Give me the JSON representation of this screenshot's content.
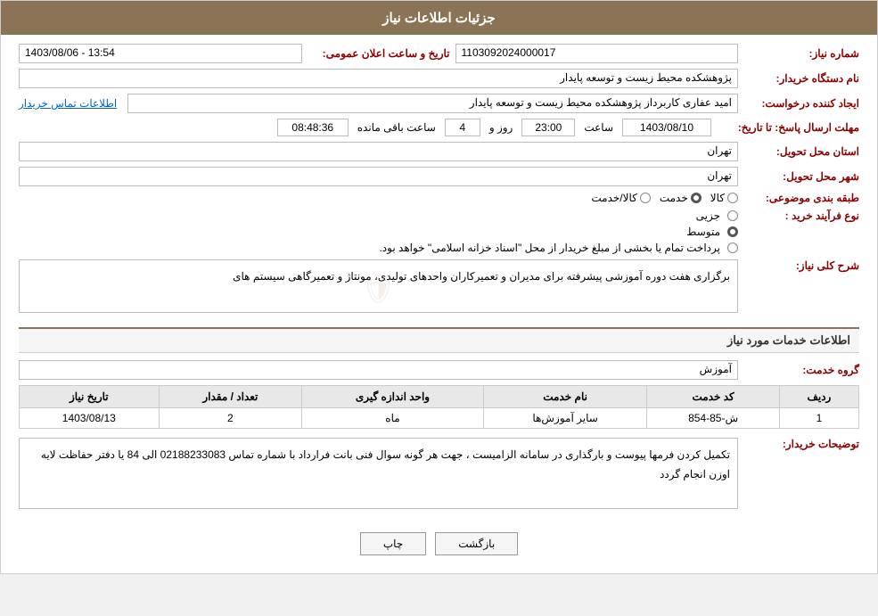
{
  "header": {
    "title": "جزئیات اطلاعات نیاز"
  },
  "fields": {
    "need_number_label": "شماره نیاز:",
    "need_number_value": "1103092024000017",
    "buyer_org_label": "نام دستگاه خریدار:",
    "buyer_org_value": "پژوهشکده محیط زیست و توسعه پایدار",
    "creator_label": "ایجاد کننده درخواست:",
    "creator_value": "امید عفاری کاربرداز پژوهشکده محیط زیست و توسعه پایدار",
    "creator_link": "اطلاعات تماس خریدار",
    "announce_datetime_label": "تاریخ و ساعت اعلان عمومی:",
    "announce_datetime_value": "1403/08/06 - 13:54",
    "reply_deadline_label": "مهلت ارسال پاسخ: تا تاریخ:",
    "reply_date": "1403/08/10",
    "reply_time_label": "ساعت",
    "reply_time": "23:00",
    "reply_days_label": "روز و",
    "reply_days": "4",
    "remaining_label": "ساعت باقی مانده",
    "remaining_time": "08:48:36",
    "province_label": "استان محل تحویل:",
    "province_value": "تهران",
    "city_label": "شهر محل تحویل:",
    "city_value": "تهران",
    "category_label": "طبقه بندی موضوعی:",
    "category_options": [
      {
        "label": "کالا",
        "selected": false
      },
      {
        "label": "خدمت",
        "selected": true
      },
      {
        "label": "کالا/خدمت",
        "selected": false
      }
    ],
    "process_type_label": "نوع فرآیند خرید :",
    "process_options": [
      {
        "label": "جزیی",
        "selected": false
      },
      {
        "label": "متوسط",
        "selected": true
      },
      {
        "label": "پرداخت تمام یا بخشی از مبلغ خریدار از محل \"اسناد خزانه اسلامی\" خواهد بود.",
        "selected": false
      }
    ],
    "description_label": "شرح کلی نیاز:",
    "description_value": "برگزاری هفت دوره آموزشی پیشرفته برای مدیران و تعمیرکاران واحدهای تولیدی، مونتاژ و تعمیرگاهی سیستم های",
    "services_section_label": "اطلاعات خدمات مورد نیاز",
    "service_group_label": "گروه خدمت:",
    "service_group_value": "آموزش",
    "table": {
      "headers": [
        "ردیف",
        "کد خدمت",
        "نام خدمت",
        "واحد اندازه گیری",
        "تعداد / مقدار",
        "تاریخ نیاز"
      ],
      "rows": [
        {
          "row": "1",
          "code": "ش-85-854",
          "name": "سایر آموزش‌ها",
          "unit": "ماه",
          "quantity": "2",
          "date": "1403/08/13"
        }
      ]
    },
    "buyer_notes_label": "توضیحات خریدار:",
    "buyer_notes_value": "تکمیل کردن فرمها پیوست و بارگذاری در سامانه الزامیست ، جهت هر گونه سوال فنی بانت فرارداد  با شماره تماس 02188233083 الی 84 یا دفتر حفاظت لایه اوزن انجام گردد"
  },
  "buttons": {
    "back_label": "بازگشت",
    "print_label": "چاپ"
  }
}
